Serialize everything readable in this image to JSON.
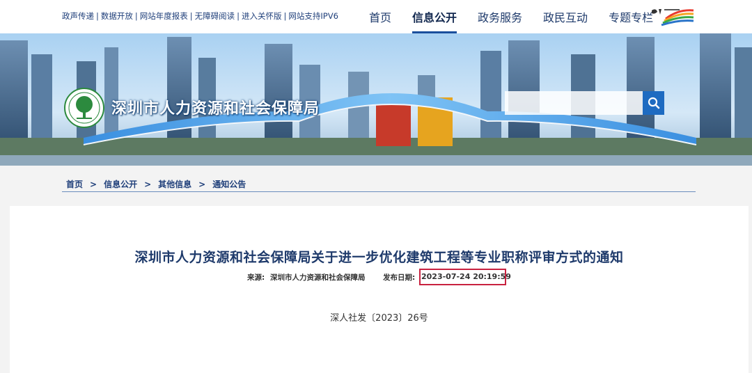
{
  "topbar": {
    "util_links": [
      "政声传递",
      "数据开放",
      "网站年度报表",
      "无障碍阅读",
      "进入关怀版",
      "网站支持IPV6"
    ],
    "nav": [
      {
        "label": "首页",
        "active": false
      },
      {
        "label": "信息公开",
        "active": true
      },
      {
        "label": "政务服务",
        "active": false
      },
      {
        "label": "政民互动",
        "active": false
      },
      {
        "label": "专题专栏",
        "active": false
      }
    ],
    "logo_icon": "shenzhen-china-logo"
  },
  "banner": {
    "bureau_name": "深圳市人力资源和社会保障局",
    "emblem_icon": "tree-emblem-icon",
    "search_placeholder": "",
    "search_icon": "search-icon"
  },
  "breadcrumb": [
    "首页",
    "信息公开",
    "其他信息",
    "通知公告"
  ],
  "article": {
    "title": "深圳市人力资源和社会保障局关于进一步优化建筑工程等专业职称评审方式的通知",
    "source_label": "来源:",
    "source_value": "深圳市人力资源和社会保障局",
    "date_label": "发布日期:",
    "date_value": "2023-07-24 20:19:59",
    "doc_number": "深人社发〔2023〕26号"
  },
  "colors": {
    "nav_text": "#1e3a6b",
    "title": "#1e3a6b",
    "highlight_box": "#c8213f",
    "search_button": "#1e6bc1"
  }
}
